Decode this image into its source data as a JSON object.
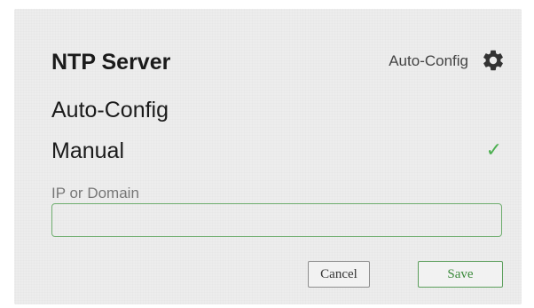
{
  "header": {
    "title": "NTP Server",
    "mode": "Auto-Config",
    "settings_icon": "gear-icon"
  },
  "options": {
    "auto_label": "Auto-Config",
    "manual_label": "Manual",
    "selected": "Manual",
    "check_glyph": "✓"
  },
  "ip_field": {
    "label": "IP or Domain",
    "value": ""
  },
  "buttons": {
    "cancel_label": "Cancel",
    "save_label": "Save"
  },
  "colors": {
    "accent_green": "#4caf50",
    "panel_bg": "#ededed"
  }
}
